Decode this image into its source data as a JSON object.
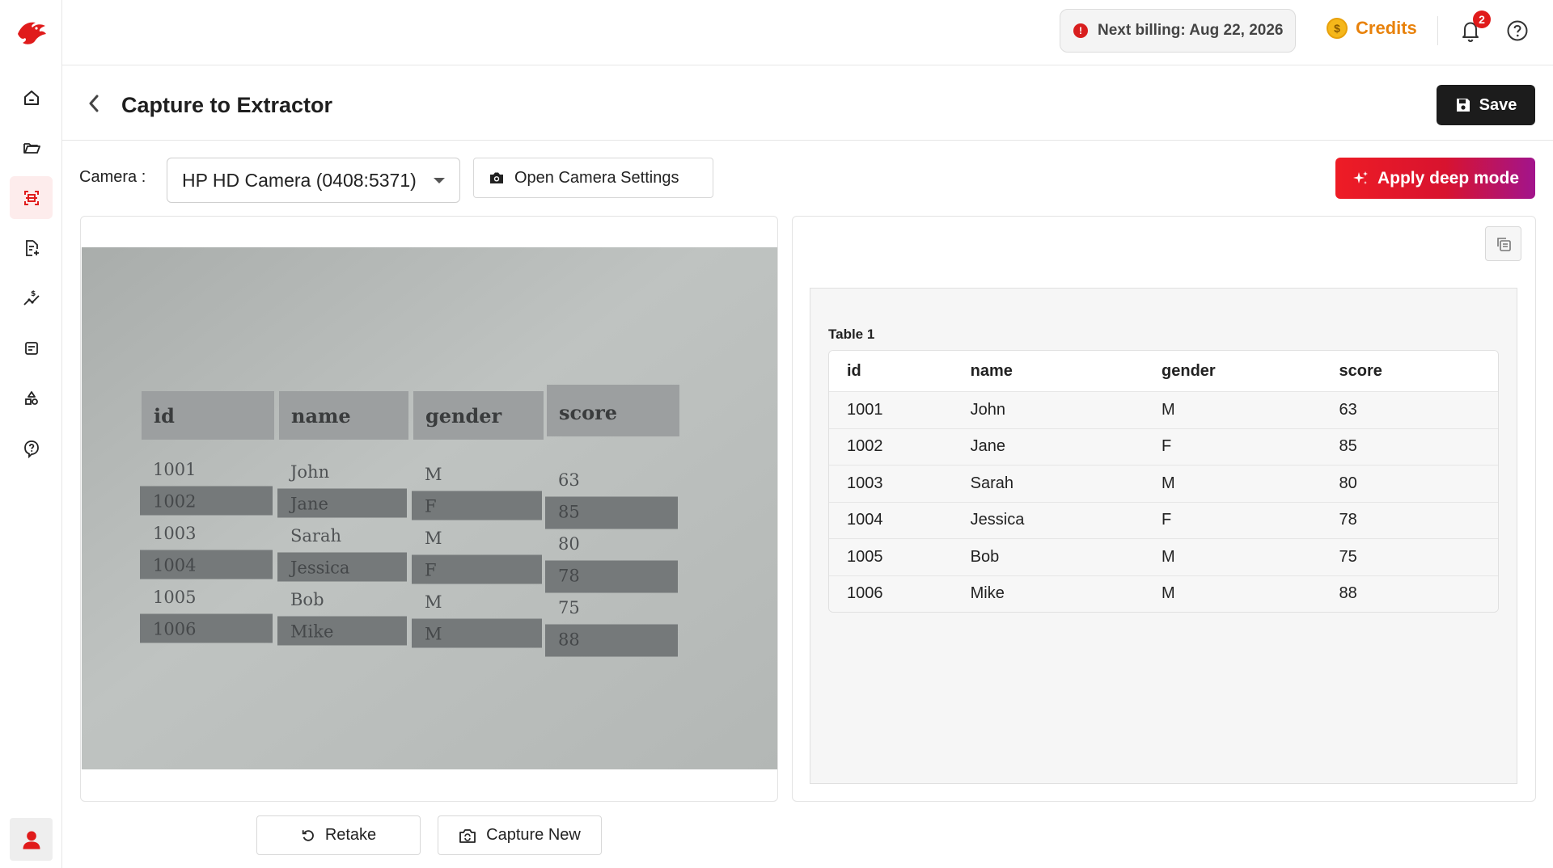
{
  "sidebar": {
    "items": [
      {
        "name": "home",
        "icon": "home-icon"
      },
      {
        "name": "folder",
        "icon": "folder-icon"
      },
      {
        "name": "capture",
        "icon": "scan-icon",
        "active": true
      },
      {
        "name": "document-add",
        "icon": "document-add-icon"
      },
      {
        "name": "billing-chart",
        "icon": "dollar-chart-icon"
      },
      {
        "name": "forms",
        "icon": "form-icon"
      },
      {
        "name": "shapes",
        "icon": "shapes-icon"
      },
      {
        "name": "help",
        "icon": "help-icon"
      }
    ],
    "profile_icon": "user-icon"
  },
  "header": {
    "billing_text": "Next billing: Aug 22, 2026",
    "credits_label": "Credits",
    "notification_count": "2"
  },
  "page": {
    "title": "Capture to Extractor",
    "save_label": "Save"
  },
  "camera": {
    "label": "Camera :",
    "selected": "HP HD Camera (0408:5371)",
    "open_settings_label": "Open Camera Settings",
    "deep_mode_label": "Apply deep mode"
  },
  "actions": {
    "retake_label": "Retake",
    "capture_new_label": "Capture New"
  },
  "photo_table": {
    "headers": [
      "id",
      "name",
      "gender",
      "score"
    ],
    "rows": [
      [
        "1001",
        "John",
        "M",
        "63"
      ],
      [
        "1002",
        "Jane",
        "F",
        "85"
      ],
      [
        "1003",
        "Sarah",
        "M",
        "80"
      ],
      [
        "1004",
        "Jessica",
        "F",
        "78"
      ],
      [
        "1005",
        "Bob",
        "M",
        "75"
      ],
      [
        "1006",
        "Mike",
        "M",
        "88"
      ]
    ]
  },
  "result": {
    "caption": "Table 1",
    "headers": [
      "id",
      "name",
      "gender",
      "score"
    ],
    "rows": [
      [
        "1001",
        "John",
        "M",
        "63"
      ],
      [
        "1002",
        "Jane",
        "F",
        "85"
      ],
      [
        "1003",
        "Sarah",
        "M",
        "80"
      ],
      [
        "1004",
        "Jessica",
        "F",
        "78"
      ],
      [
        "1005",
        "Bob",
        "M",
        "75"
      ],
      [
        "1006",
        "Mike",
        "M",
        "88"
      ]
    ]
  },
  "colors": {
    "accent_red": "#e01b1b",
    "credits_orange": "#e8820c",
    "deep_mode_gradient_start": "#ee1c25",
    "deep_mode_gradient_end": "#a2148c",
    "save_bg": "#1c1c1c"
  }
}
